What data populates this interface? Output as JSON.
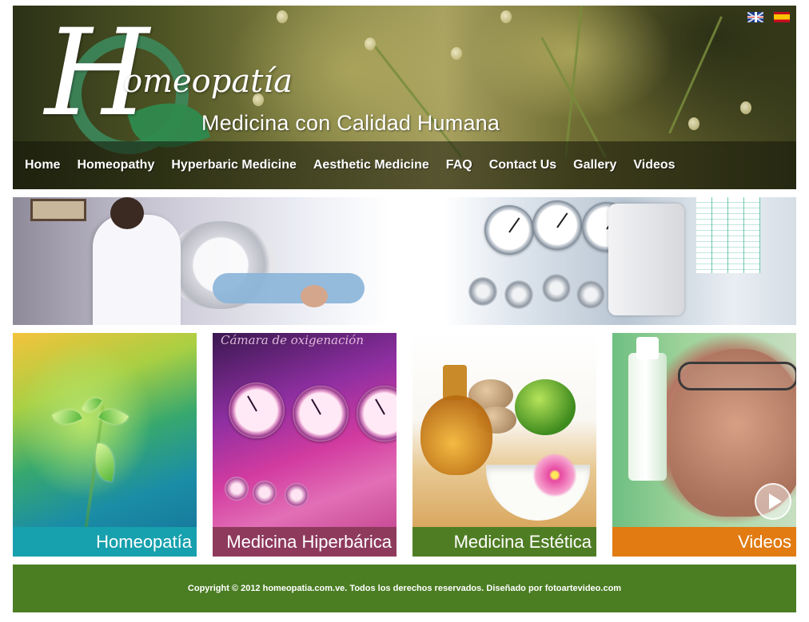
{
  "header": {
    "logo_letter": "H",
    "logo_word": "omeopatía",
    "tagline": "Medicina con Calidad Humana",
    "languages": [
      {
        "code": "en",
        "icon": "uk-flag-icon"
      },
      {
        "code": "es",
        "icon": "spain-flag-icon"
      }
    ]
  },
  "nav": {
    "items": [
      {
        "label": "Home"
      },
      {
        "label": "Homeopathy"
      },
      {
        "label": "Hyperbaric Medicine"
      },
      {
        "label": "Aesthetic Medicine"
      },
      {
        "label": "FAQ"
      },
      {
        "label": "Contact Us"
      },
      {
        "label": "Gallery"
      },
      {
        "label": "Videos"
      }
    ]
  },
  "hero": {
    "image": "hyperbaric-chamber-photo"
  },
  "tiles": [
    {
      "label": "Homeopatía",
      "color": "#17a0ad",
      "image": "sprout-photo"
    },
    {
      "label": "Medicina Hiperbárica",
      "color": "#8e3a5d",
      "image": "pressure-gauges-photo",
      "photo_text": "Cámara de oxigenación"
    },
    {
      "label": "Medicina Estética",
      "color": "#4f7d24",
      "image": "spa-oils-photo"
    },
    {
      "label": "Videos",
      "color": "#e17b12",
      "image": "doctor-vial-photo",
      "icon": "play-icon"
    }
  ],
  "footer": {
    "copyright": "Copyright © 2012 homeopatia.com.ve. Todos los derechos reservados. Diseñado por fotoartevideo.com",
    "color": "#4b7d23"
  }
}
